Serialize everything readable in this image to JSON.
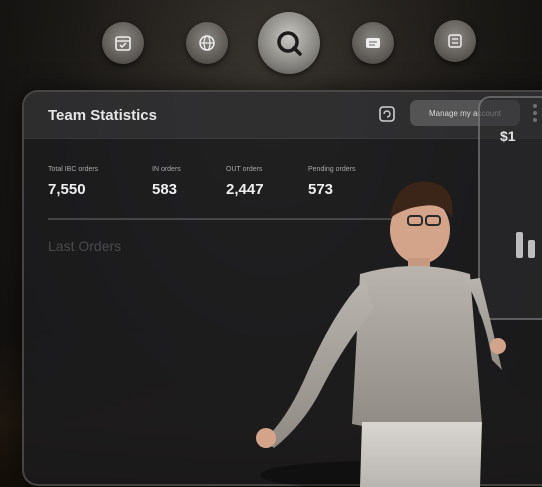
{
  "dock": {
    "items": [
      {
        "icon": "calendar-icon"
      },
      {
        "icon": "globe-icon"
      },
      {
        "icon": "search-icon",
        "active": true
      },
      {
        "icon": "chat-icon"
      },
      {
        "icon": "settings-icon"
      }
    ]
  },
  "panel": {
    "title": "Team Statistics",
    "header_button": "Manage my account",
    "stats": [
      {
        "label": "Total IBC orders",
        "value": "7,550"
      },
      {
        "label": "IN orders",
        "value": "583"
      },
      {
        "label": "OUT orders",
        "value": "2,447"
      },
      {
        "label": "Pending orders",
        "value": "573"
      }
    ],
    "section_title": "Last Orders"
  },
  "side_widget": {
    "value": "$1"
  },
  "colors": {
    "panel_bg": "#1c1c1e",
    "text": "#efefef",
    "muted": "#a8a8a8"
  }
}
